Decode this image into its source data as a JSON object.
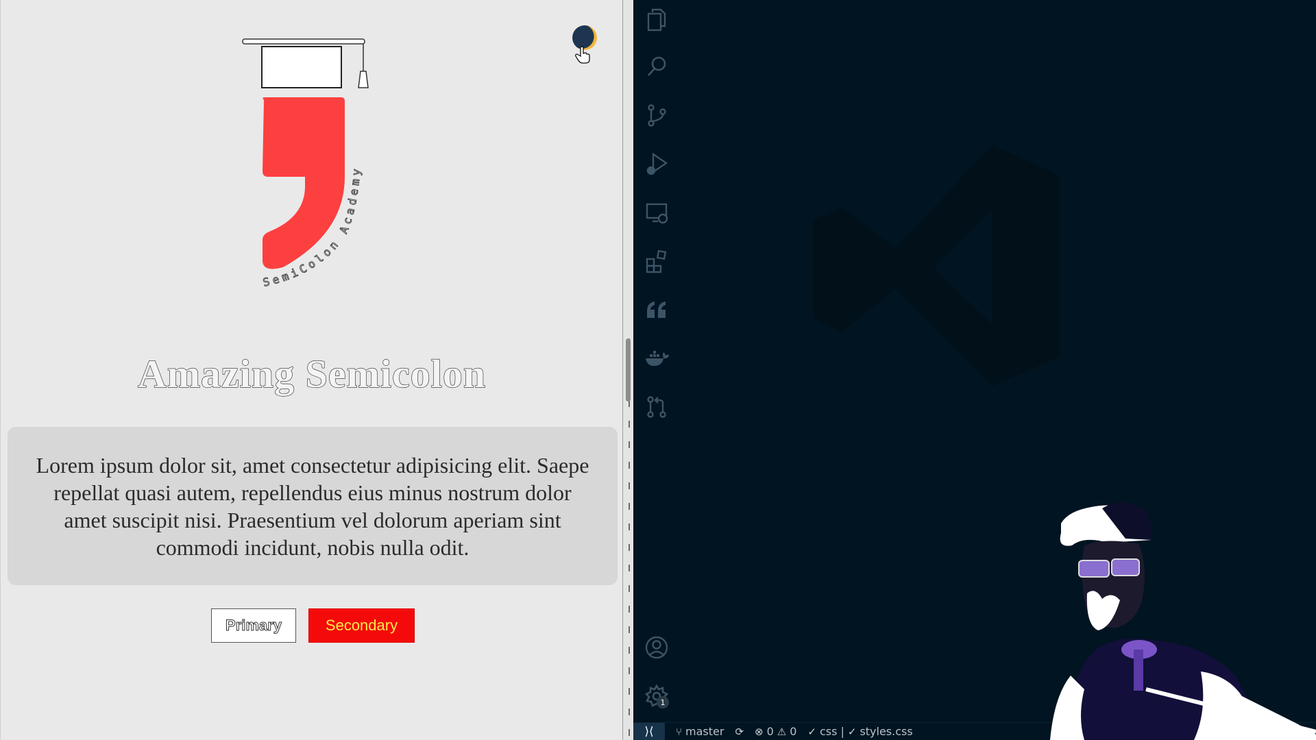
{
  "preview": {
    "logo_text": "SemiColon Academy",
    "title": "Amazing Semicolon",
    "paragraph": "Lorem ipsum dolor sit, amet consectetur adipisicing elit. Saepe repellat quasi autem, repellendus eius minus nostrum dolor amet suscipit nisi. Praesentium vel dolorum aperiam sint commodi incidunt, nobis nulla odit.",
    "buttons": {
      "primary": "Primary",
      "secondary": "Secondary"
    },
    "colors": {
      "brand_red": "#fc4040",
      "secondary_bg": "#f40a0a",
      "secondary_text": "#ffe94a"
    }
  },
  "vscode": {
    "activity_bar": [
      "files-icon",
      "search-icon",
      "source-control-icon",
      "run-debug-icon",
      "remote-explorer-icon",
      "extensions-icon",
      "quote-icon",
      "docker-icon",
      "pull-request-icon",
      "account-icon",
      "settings-gear-icon"
    ],
    "settings_badge": "1",
    "status_bar": {
      "remote": "⟩⟨",
      "branch": "master",
      "errors": "0",
      "warnings": "0",
      "language": "css",
      "separator": "|",
      "file": "styles.css"
    }
  }
}
